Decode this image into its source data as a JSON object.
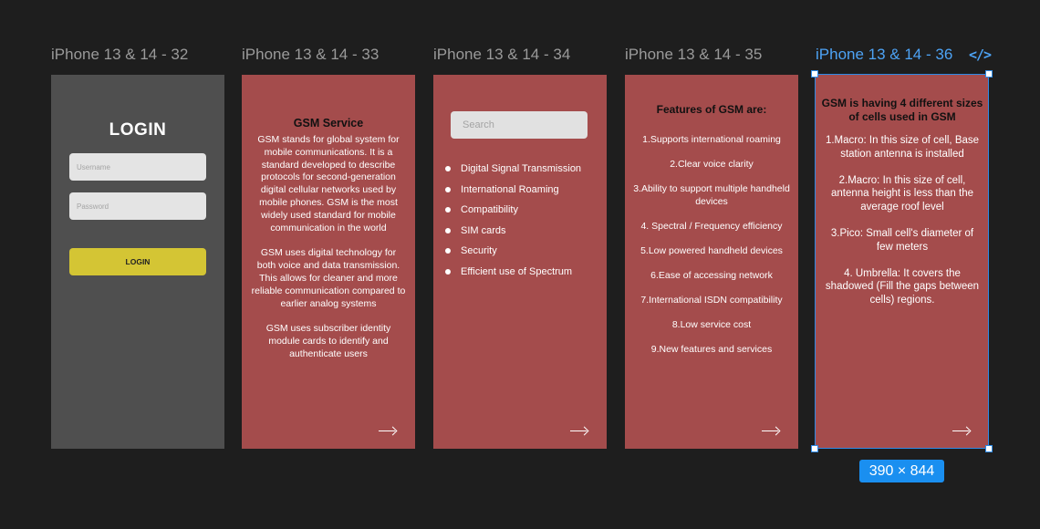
{
  "frames": [
    {
      "title": "iPhone 13 & 14 - 32"
    },
    {
      "title": "iPhone 13 & 14 - 33"
    },
    {
      "title": "iPhone 13 & 14 - 34"
    },
    {
      "title": "iPhone 13 & 14 - 35"
    },
    {
      "title": "iPhone 13 & 14 - 36"
    }
  ],
  "login": {
    "title": "LOGIN",
    "username_placeholder": "Username",
    "password_placeholder": "Password",
    "button_label": "LOGIN"
  },
  "gsm_service": {
    "title": "GSM Service",
    "paragraphs": [
      "GSM stands for global system for mobile communications. It is a standard developed to describe protocols for second-generation digital cellular networks used by mobile phones. GSM is the most widely used standard for mobile communication in the world",
      "GSM uses digital technology for both voice and data transmission. This allows for cleaner and more reliable communication compared to earlier analog systems",
      "GSM uses subscriber identity module cards to identify and authenticate users"
    ]
  },
  "search_screen": {
    "search_placeholder": "Search",
    "items": [
      "Digital Signal Transmission",
      "International Roaming",
      "Compatibility",
      "SIM cards",
      "Security",
      "Efficient use of Spectrum"
    ]
  },
  "features": {
    "title": "Features of GSM are:",
    "items": [
      "1.Supports international roaming",
      "2.Clear voice clarity",
      "3.Ability to support multiple handheld devices",
      "4. Spectral / Frequency efficiency",
      "5.Low powered handheld devices",
      "6.Ease of accessing network",
      "7.International ISDN compatibility",
      "8.Low service cost",
      "9.New features and services"
    ]
  },
  "cells": {
    "title": "GSM is having 4 different sizes of cells used in GSM",
    "items": [
      "1.Macro: In this size of cell, Base station antenna is installed",
      "2.Macro: In this size of cell, antenna height is less than the average roof level",
      "3.Pico: Small cell's diameter of few meters",
      "4. Umbrella: It covers the shadowed (Fill the gaps between cells) regions."
    ]
  },
  "selection": {
    "size_label": "390 × 844",
    "code_icon": "</>"
  },
  "colors": {
    "canvas": "#1e1e1e",
    "frame_red": "#a44c4c",
    "frame_dark": "#4f4f4f",
    "login_button": "#d4c534",
    "selection_blue": "#2e8ae6"
  },
  "icons": {
    "next_arrow": "long-right-arrow-icon",
    "code": "code-brackets-icon"
  }
}
